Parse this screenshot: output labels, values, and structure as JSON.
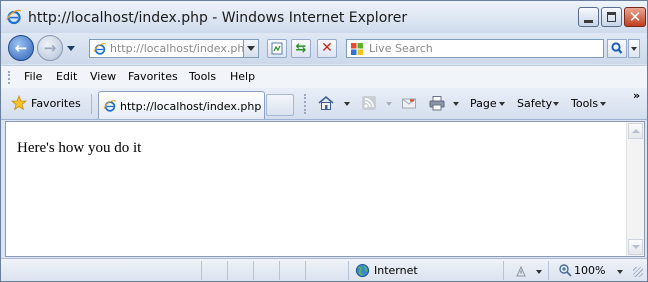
{
  "window": {
    "title": "http://localhost/index.php - Windows Internet Explorer",
    "controls": {
      "minimize": "minimize",
      "maximize": "maximize",
      "close": "✕"
    }
  },
  "nav": {
    "address_host": "http://localhost",
    "address_path": "/index.php",
    "search_placeholder": "Live Search"
  },
  "menu": {
    "items": [
      "File",
      "Edit",
      "View",
      "Favorites",
      "Tools",
      "Help"
    ]
  },
  "favbar": {
    "favorites_label": "Favorites",
    "tab_label": "http://localhost/index.php",
    "commands": {
      "page": "Page",
      "safety": "Safety",
      "tools": "Tools"
    },
    "overflow": "»"
  },
  "content": {
    "text": "Here's how you do it"
  },
  "status": {
    "zone": "Internet",
    "zoom": "100%"
  },
  "colors": {
    "ie_blue": "#1f6fd0",
    "stop_red": "#c62a16",
    "refresh_green": "#2f8f2a"
  }
}
